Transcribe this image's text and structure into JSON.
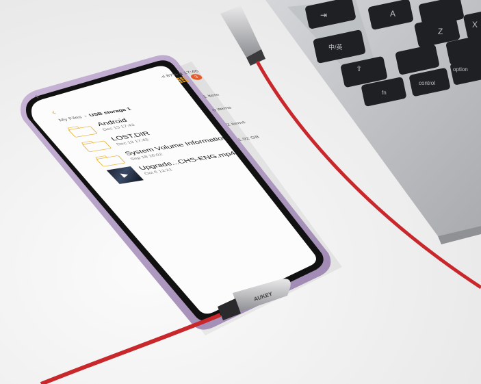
{
  "status_bar": {
    "signal": "⚲",
    "text": ".ıl 87% ▮ 17:46"
  },
  "header": {
    "notification_count": "3"
  },
  "breadcrumb": {
    "root": "My Files",
    "current": "USB storage 1",
    "count": "1 item"
  },
  "files": [
    {
      "name": "Android",
      "date": "Dec 13 17:43",
      "meta": "0 items",
      "kind": "folder"
    },
    {
      "name": "LOST.DIR",
      "date": "Dec 13 17:43",
      "meta": "2 items",
      "kind": "folder"
    },
    {
      "name": "System Volume Information",
      "date": "Sep 18 16:02",
      "meta": "1.92 GB",
      "kind": "folder"
    },
    {
      "name": "Upgrade...CHS-ENG.mp4",
      "date": "Oct 6 12:21",
      "meta": "",
      "kind": "video"
    }
  ],
  "cable": {
    "brand": "AUKEY",
    "color": "#d42a2f"
  },
  "keyboard": {
    "keys": [
      "⇥",
      "A",
      "Z",
      "X",
      "中/英",
      "⇧",
      "fn",
      "control",
      "option"
    ]
  },
  "colors": {
    "accent": "#e8a326",
    "phone_frame": "#b39ec4",
    "laptop": "#c3c5c8"
  }
}
